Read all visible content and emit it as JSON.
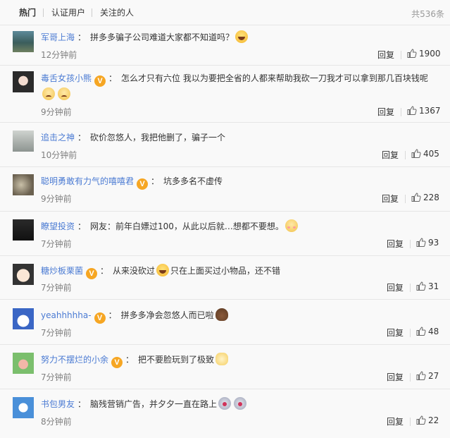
{
  "tabs": [
    "热门",
    "认证用户",
    "关注的人"
  ],
  "total": "共536条",
  "reply_label": "回复",
  "comments": [
    {
      "user": "军哥上海",
      "verified": false,
      "text": "拼多多骗子公司难道大家都不知道吗？",
      "emoji": [
        "laugh"
      ],
      "time": "12分钟前",
      "likes": "1900"
    },
    {
      "user": "毒舌女孩小熊",
      "verified": true,
      "text": "怎么才只有六位 我以为要把全省的人都来帮助我砍一刀我才可以拿到那几百块钱呢",
      "emoji": [
        "sad",
        "sad"
      ],
      "time": "9分钟前",
      "likes": "1367"
    },
    {
      "user": "追击之神",
      "verified": false,
      "text": "砍价忽悠人，我把他删了，骗子一个",
      "emoji": [],
      "time": "10分钟前",
      "likes": "405"
    },
    {
      "user": "聪明勇敢有力气的嘻嘻君",
      "verified": true,
      "text": "坑多多名不虚传",
      "emoji": [],
      "time": "9分钟前",
      "likes": "228"
    },
    {
      "user": "瞭望投资",
      "verified": false,
      "text": "网友：前年白嫖过100，从此以后就…想都不要想。",
      "emoji": [
        "shy"
      ],
      "time": "7分钟前",
      "likes": "93"
    },
    {
      "user": "糖炒板栗菌",
      "verified": true,
      "text_before": "从来没砍过",
      "text_after": "只在上面买过小物品，还不错",
      "emoji": [
        "laugh"
      ],
      "time": "7分钟前",
      "likes": "31"
    },
    {
      "user": "yeahhhhha-",
      "verified": true,
      "text": "拼多多净会忽悠人而已啦",
      "emoji": [
        "poop"
      ],
      "time": "7分钟前",
      "likes": "48"
    },
    {
      "user": "努力不摆烂的小余",
      "verified": true,
      "text": "把不要脸玩到了极致",
      "emoji": [
        "cat"
      ],
      "time": "7分钟前",
      "likes": "27"
    },
    {
      "user": "书包男友",
      "verified": false,
      "text": "脑残营销广告，并夕夕一直在路上",
      "emoji": [
        "pig",
        "pig"
      ],
      "time": "8分钟前",
      "likes": "22"
    }
  ],
  "colors": {
    "username": "#eb7350",
    "verified": "#f6a623",
    "time": "#808080"
  }
}
